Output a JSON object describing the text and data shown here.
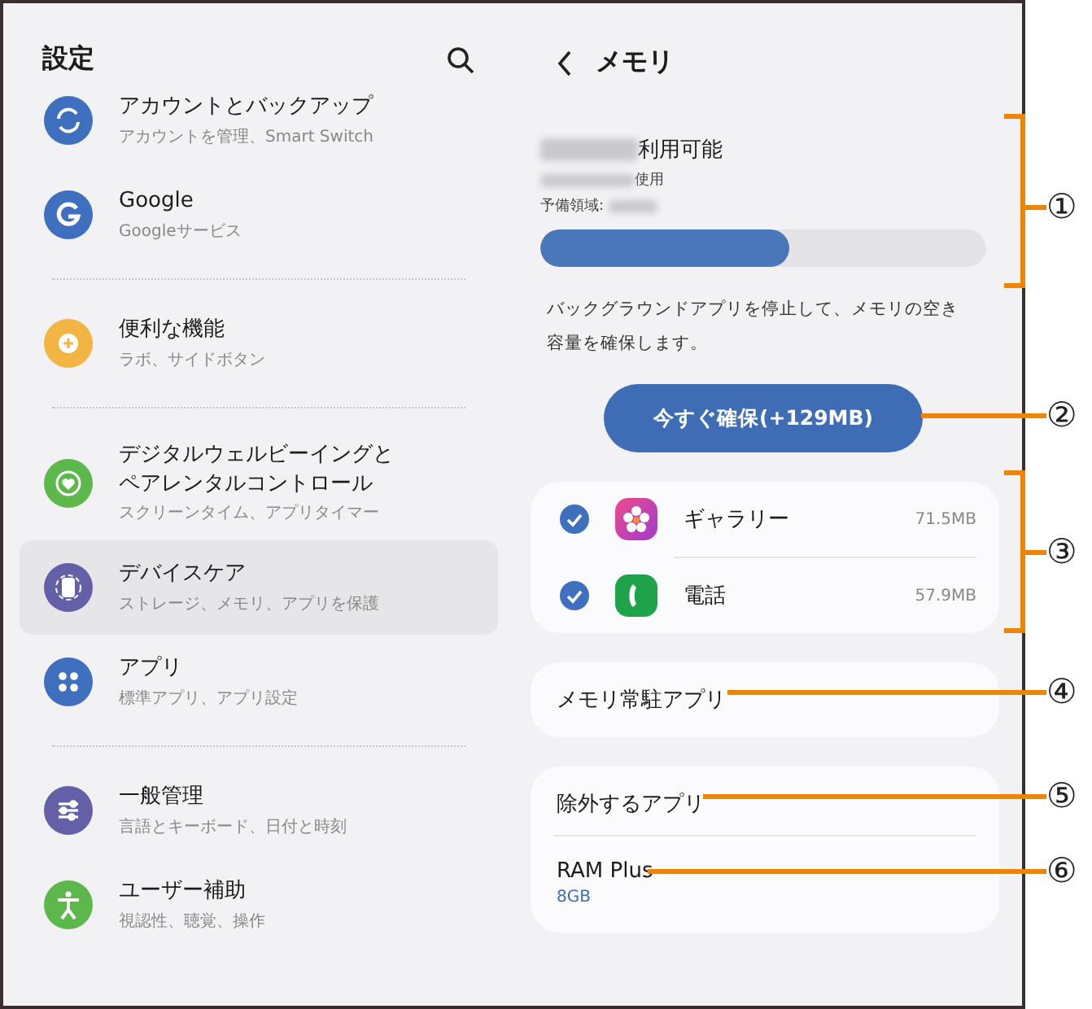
{
  "settings": {
    "title": "設定",
    "groups": [
      [
        {
          "title": "アカウントとバックアップ",
          "subtitle": "アカウントを管理、Smart Switch",
          "color": "#3f6fbf",
          "selected": false
        },
        {
          "title": "Google",
          "subtitle": "Googleサービス",
          "color": "#3f6fbf",
          "selected": false
        }
      ],
      [
        {
          "title": "便利な機能",
          "subtitle": "ラボ、サイドボタン",
          "color": "#f2b544",
          "selected": false
        }
      ],
      [
        {
          "title": "デジタルウェルビーイングとペアレンタルコントロール",
          "subtitle": "スクリーンタイム、アプリタイマー",
          "color": "#5cb84a",
          "selected": false
        },
        {
          "title": "デバイスケア",
          "subtitle": "ストレージ、メモリ、アプリを保護",
          "color": "#6460a8",
          "selected": true
        },
        {
          "title": "アプリ",
          "subtitle": "標準アプリ、アプリ設定",
          "color": "#3f6fbf",
          "selected": false
        }
      ],
      [
        {
          "title": "一般管理",
          "subtitle": "言語とキーボード、日付と時刻",
          "color": "#6460a8",
          "selected": false
        },
        {
          "title": "ユーザー補助",
          "subtitle": "視認性、聴覚、操作",
          "color": "#5cb84a",
          "selected": false
        }
      ]
    ]
  },
  "memory": {
    "title": "メモリ",
    "available_label": "利用可能",
    "used_label": "使用",
    "reserve_label": "予備領域:",
    "level": 0.56,
    "description": "バックグラウンドアプリを停止して、メモリの空き容量を確保します。",
    "button": "今すぐ確保(+129MB)",
    "apps": [
      {
        "name": "ギャラリー",
        "size": "71.5MB",
        "checked": true
      },
      {
        "name": "電話",
        "size": "57.9MB",
        "checked": true
      }
    ],
    "resident_apps": "メモリ常駐アプリ",
    "excluded_apps": "除外するアプリ",
    "ram_plus": {
      "title": "RAM Plus",
      "value": "8GB"
    }
  },
  "callouts": [
    "①",
    "②",
    "③",
    "④",
    "⑤",
    "⑥"
  ]
}
